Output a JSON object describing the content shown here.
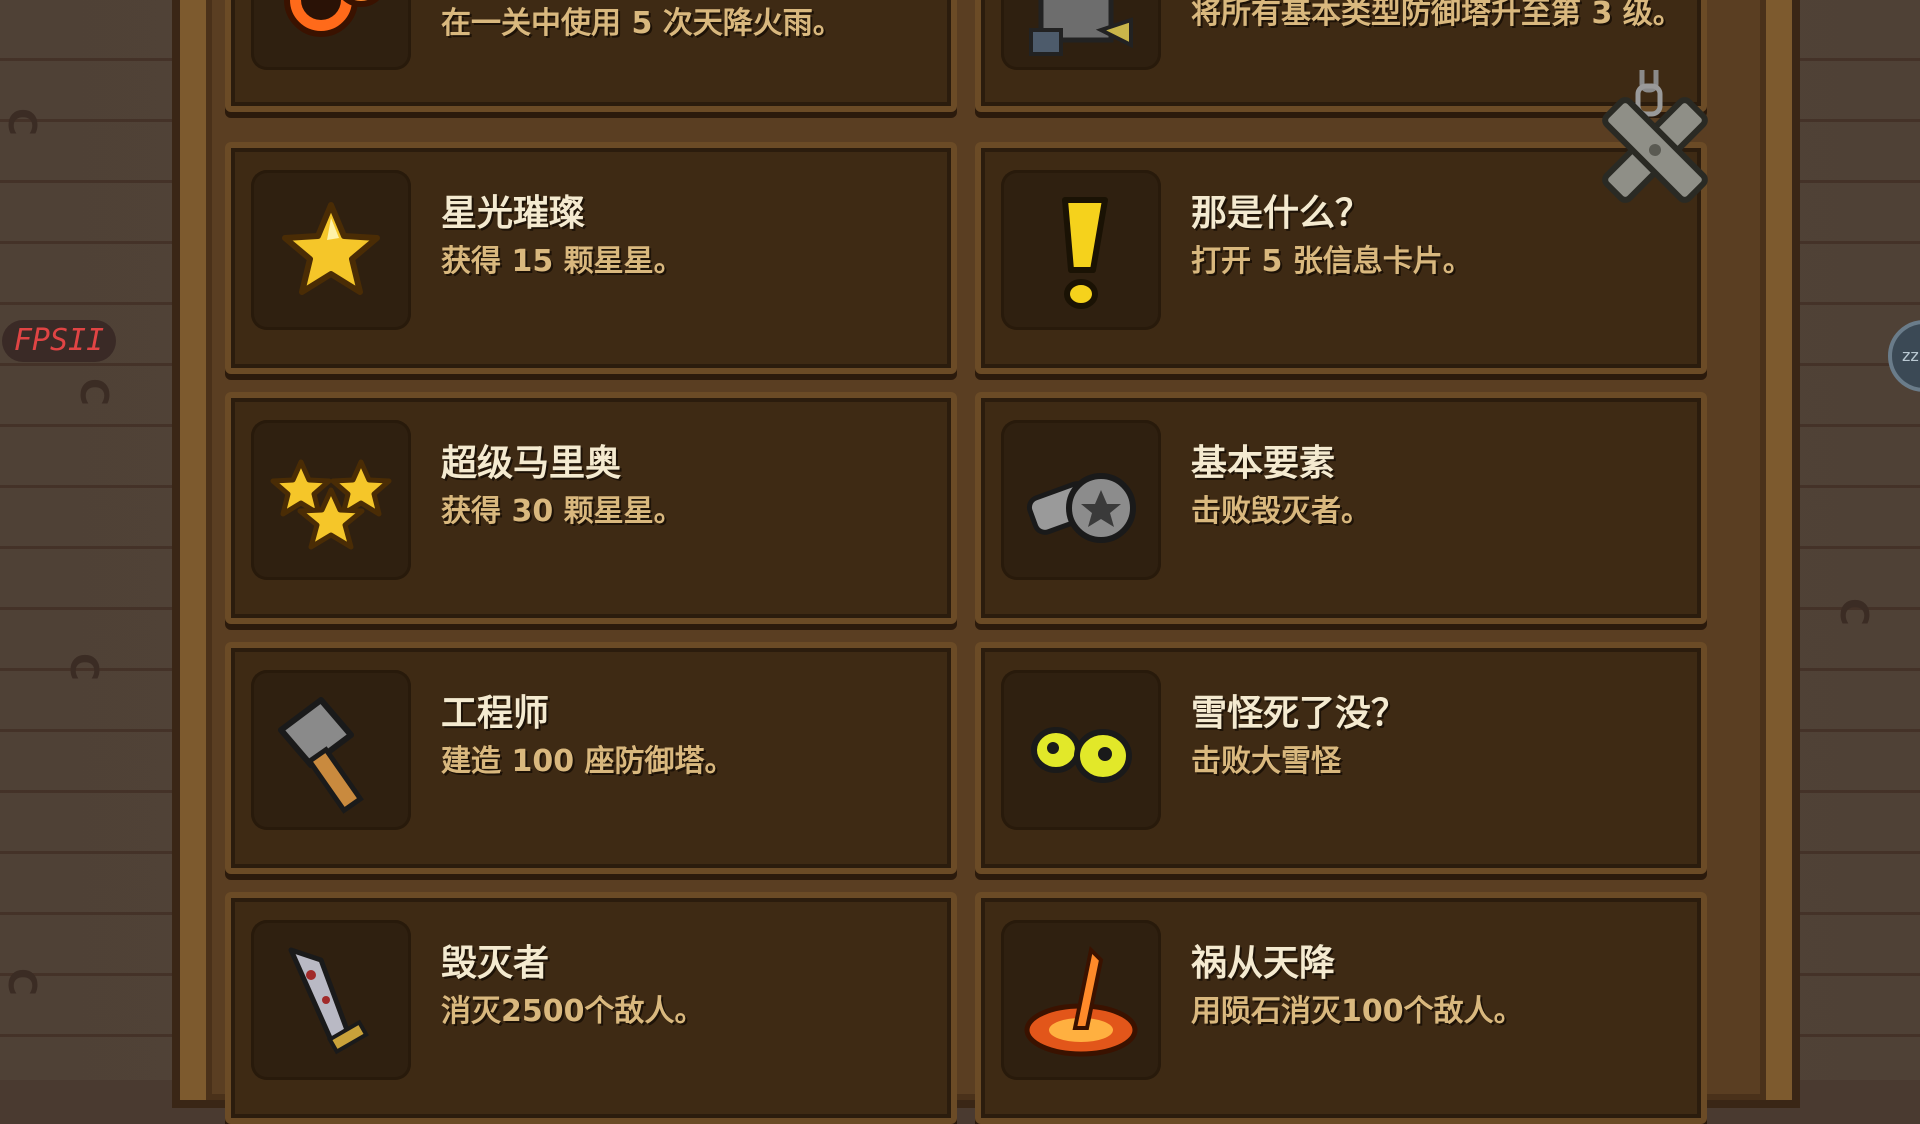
{
  "fps_label": "FPSII",
  "side_orb_label": "zz",
  "achievements": [
    {
      "id": "top-left",
      "title": "",
      "desc": "在一关中使用 5 次天降火雨。",
      "icon": "fireball-icon",
      "col": 0
    },
    {
      "id": "top-right",
      "title": "",
      "desc": "将所有基本类型防御塔升至第 3 级。",
      "icon": "tower-upgrade-icon",
      "col": 1
    },
    {
      "id": "starlight",
      "title": "星光璀璨",
      "desc": "获得 15 颗星星。",
      "icon": "star-icon",
      "col": 0
    },
    {
      "id": "what-is-that",
      "title": "那是什么？",
      "desc": "打开 5 张信息卡片。",
      "icon": "exclamation-icon",
      "col": 1
    },
    {
      "id": "super-mario",
      "title": "超级马里奥",
      "desc": "获得 30 颗星星。",
      "icon": "three-stars-icon",
      "col": 0
    },
    {
      "id": "basics",
      "title": "基本要素",
      "desc": "击败毁灭者。",
      "icon": "screw-bolt-icon",
      "col": 1
    },
    {
      "id": "engineer",
      "title": "工程师",
      "desc": "建造 100 座防御塔。",
      "icon": "hammer-icon",
      "col": 0
    },
    {
      "id": "yeti",
      "title": "雪怪死了没？",
      "desc": "击败大雪怪",
      "icon": "yeti-eyes-icon",
      "col": 1
    },
    {
      "id": "destroyer",
      "title": "毁灭者",
      "desc": "消灭2500个敌人。",
      "icon": "bloody-sword-icon",
      "col": 0
    },
    {
      "id": "meteor",
      "title": "祸从天降",
      "desc": "用陨石消灭100个敌人。",
      "icon": "meteor-impact-icon",
      "col": 1
    }
  ],
  "colors": {
    "title_text": "#f4ead0",
    "desc_text": "#d9b87e",
    "card_bg": "#3e2a14",
    "panel_frame": "#7d5a2e",
    "fps_text": "#e04444"
  }
}
